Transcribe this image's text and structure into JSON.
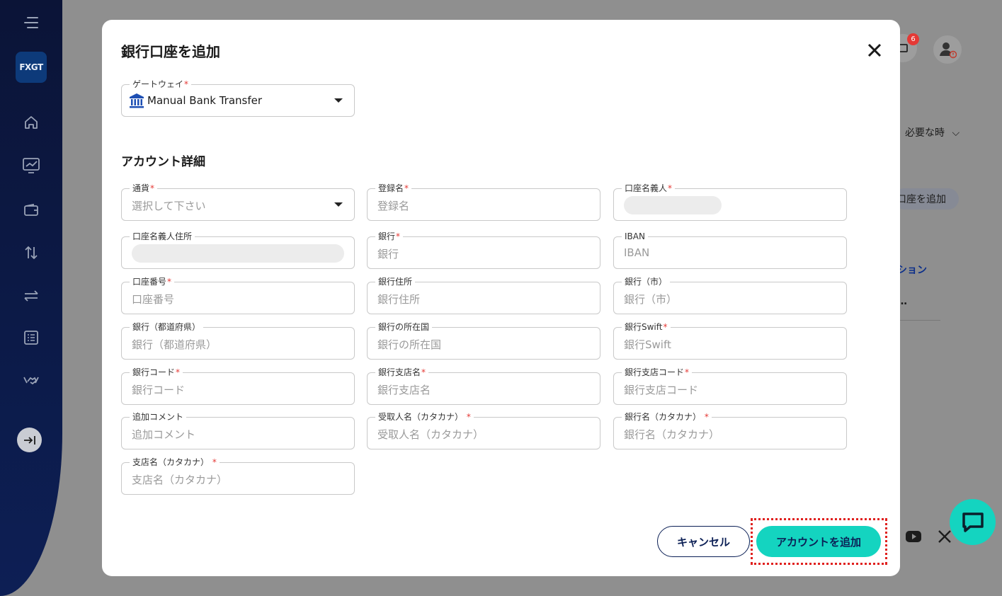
{
  "sidebar": {
    "logo_text": "FXGT",
    "icons": [
      "menu-icon",
      "home-icon",
      "chart-icon",
      "wallet-icon",
      "transfer-vertical-icon",
      "transfer-horizontal-icon",
      "list-icon",
      "handshake-icon",
      "expand-icon"
    ]
  },
  "background": {
    "notification_count": "6",
    "dropdown_label": "必要な時",
    "pill_label": "口座を追加",
    "link_text": "ション",
    "ellipsis": "…"
  },
  "modal": {
    "title": "銀行口座を追加",
    "gateway": {
      "label": "ゲートウェイ",
      "value": "Manual Bank Transfer"
    },
    "section_title": "アカウント詳細",
    "fields": {
      "currency": {
        "label": "通貨",
        "placeholder": "選択して下さい"
      },
      "reg_name": {
        "label": "登録名",
        "placeholder": "登録名"
      },
      "holder": {
        "label": "口座名義人"
      },
      "holder_address": {
        "label": "口座名義人住所"
      },
      "bank": {
        "label": "銀行",
        "placeholder": "銀行"
      },
      "iban": {
        "label": "IBAN",
        "placeholder": "IBAN"
      },
      "account_no": {
        "label": "口座番号",
        "placeholder": "口座番号"
      },
      "bank_address": {
        "label": "銀行住所",
        "placeholder": "銀行住所"
      },
      "bank_city": {
        "label": "銀行（市）",
        "placeholder": "銀行（市）"
      },
      "bank_pref": {
        "label": "銀行（都道府県）",
        "placeholder": "銀行（都道府県）"
      },
      "bank_country": {
        "label": "銀行の所在国",
        "placeholder": "銀行の所在国"
      },
      "swift": {
        "label": "銀行Swift",
        "placeholder": "銀行Swift"
      },
      "bank_code": {
        "label": "銀行コード",
        "placeholder": "銀行コード"
      },
      "branch_name": {
        "label": "銀行支店名",
        "placeholder": "銀行支店名"
      },
      "branch_code": {
        "label": "銀行支店コード",
        "placeholder": "銀行支店コード"
      },
      "comment": {
        "label": "追加コメント",
        "placeholder": "追加コメント"
      },
      "recipient_kana": {
        "label": "受取人名（カタカナ）",
        "placeholder": "受取人名（カタカナ）"
      },
      "bank_kana": {
        "label": "銀行名（カタカナ）",
        "placeholder": "銀行名（カタカナ）"
      },
      "branch_kana": {
        "label": "支店名（カタカナ）",
        "placeholder": "支店名（カタカナ）"
      }
    },
    "cancel_label": "キャンセル",
    "submit_label": "アカウントを追加"
  }
}
